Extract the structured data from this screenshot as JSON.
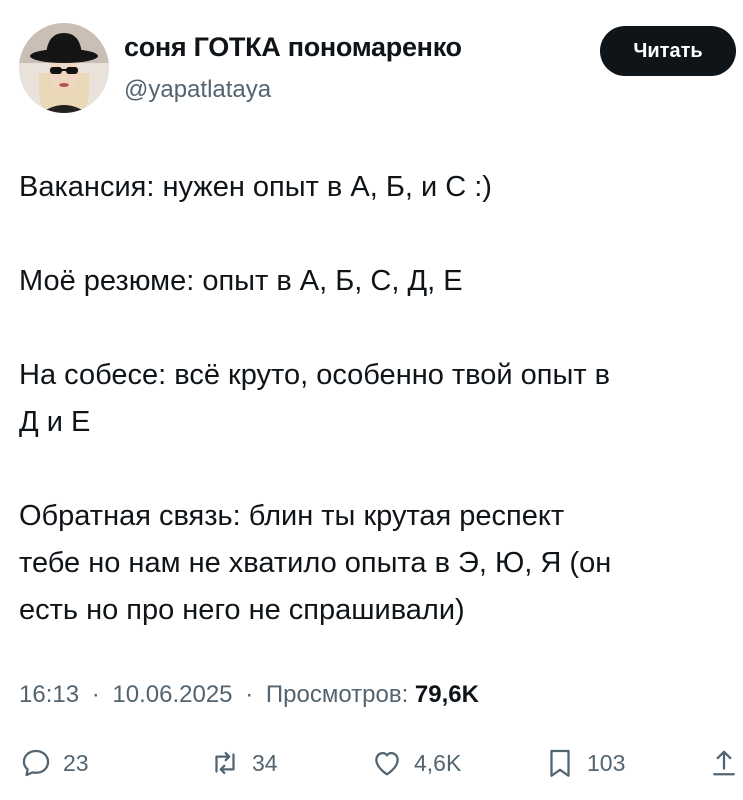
{
  "author": {
    "display_name": "соня ГОТКА пономаренко",
    "handle": "@yapatlataya",
    "avatar_icon": "avatar-photo"
  },
  "follow_button": {
    "label": "Читать"
  },
  "tweet": {
    "paragraphs": [
      [
        "Вакансия: нужен опыт в А, Б, и С :)"
      ],
      [
        "Моё резюме: опыт в А, Б, С, Д, Е"
      ],
      [
        "На собесе: всё круто, особенно твой опыт в",
        "Д и Е"
      ],
      [
        "Обратная связь: блин ты крутая респект",
        "тебе но нам не хватило опыта в Э, Ю, Я (он",
        "есть но про него не спрашивали)"
      ]
    ]
  },
  "meta": {
    "time": "16:13",
    "separator": "·",
    "date": "10.06.2025",
    "views_label": "Просмотров:",
    "views_count": "79,6K"
  },
  "actions": {
    "replies": "23",
    "retweets": "34",
    "likes": "4,6K",
    "bookmarks": "103"
  },
  "colors": {
    "text": "#0f1419",
    "secondary": "#536471",
    "button_bg": "#0f1419",
    "button_text": "#ffffff"
  }
}
